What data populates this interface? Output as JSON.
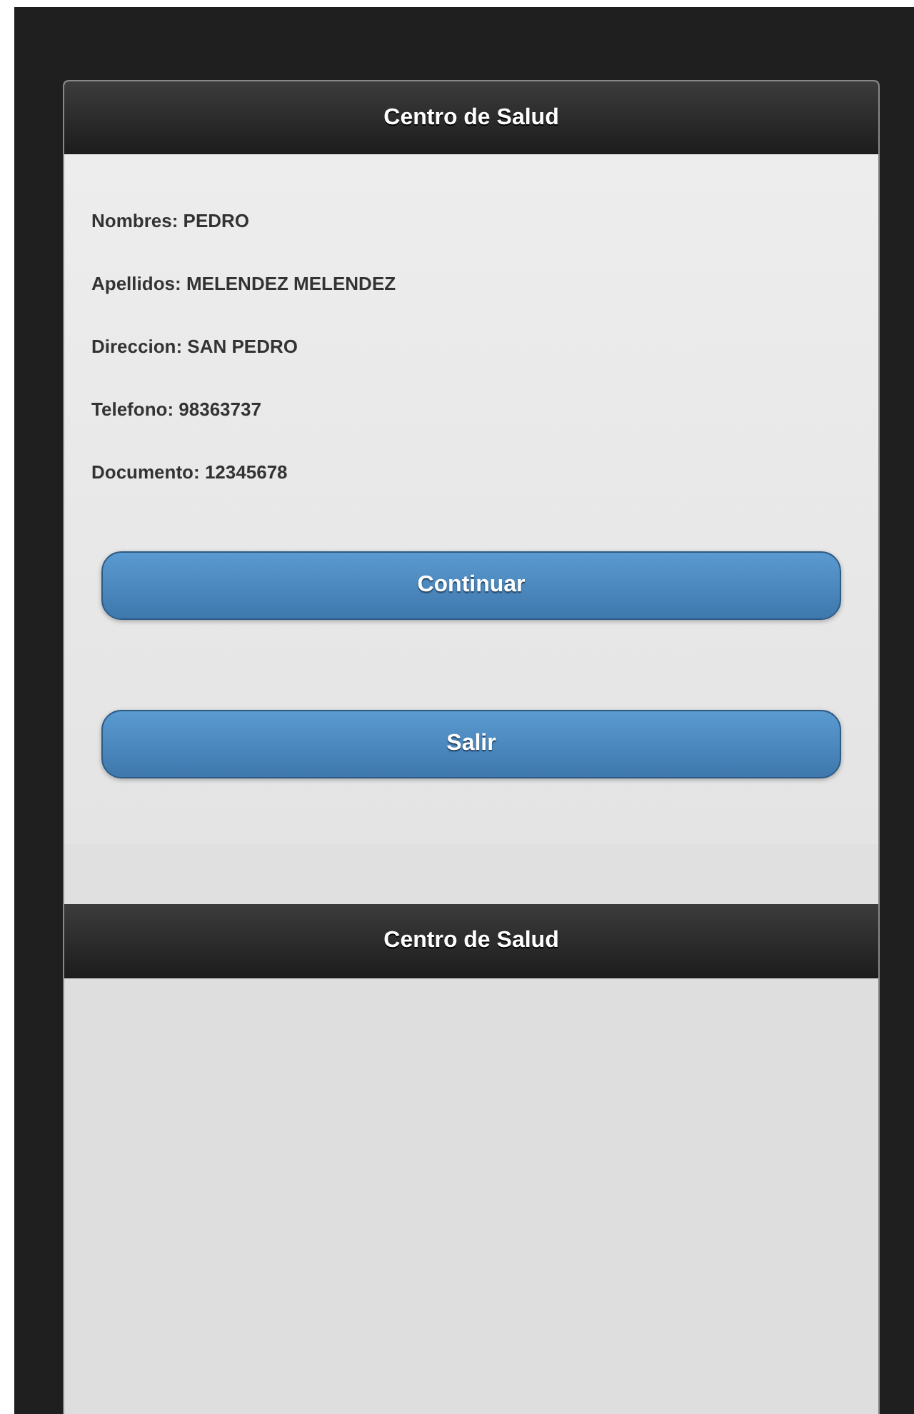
{
  "page_header": {
    "title": "Centro de Salud"
  },
  "fields": [
    "Nombres: PEDRO",
    "Apellidos: MELENDEZ MELENDEZ",
    "Direccion: SAN PEDRO",
    "Telefono: 98363737",
    "Documento: 12345678"
  ],
  "buttons": [
    "Continuar",
    "Salir"
  ],
  "second_page_header": {
    "title": "Centro de Salud"
  }
}
